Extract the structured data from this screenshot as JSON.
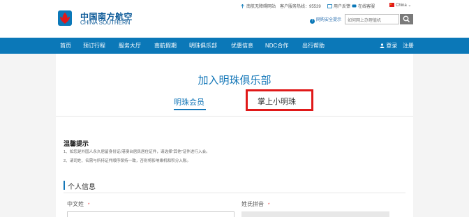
{
  "brand": {
    "name_cn": "中国南方航空",
    "name_en": "CHINA SOUTHERN",
    "accent": "#0b78b8"
  },
  "toplinks": {
    "wireless": "南航无障碍网站",
    "hotline": "客户服务热线：95539",
    "feedback": "用户反馈",
    "online_service": "在线客服",
    "region": "China"
  },
  "header": {
    "security_tip": "网购安全提示",
    "search_placeholder": "如何网上办理值机"
  },
  "nav": {
    "items": [
      "首页",
      "预订行程",
      "服务大厅",
      "南航假期",
      "明珠俱乐部",
      "优惠信息",
      "NDC合作",
      "出行帮助"
    ],
    "login": "登录",
    "register": "注册"
  },
  "page": {
    "title": "加入明珠俱乐部",
    "tabs": [
      "明珠会员",
      "掌上小明珠"
    ],
    "notice_title": "温馨提示",
    "notices": [
      "1、如您是外国人永久居留身份证/港澳台居民居住证件，请选择“其他”证件进行入会。",
      "2、请司姓、名需与所持证件顺序保持一致，否则将影响乘机和积分入账。"
    ],
    "section_title": "个人信息",
    "fields": {
      "cn_surname": "中文姓",
      "surname_pinyin": "姓氏拼音",
      "required_mark": "*"
    }
  }
}
